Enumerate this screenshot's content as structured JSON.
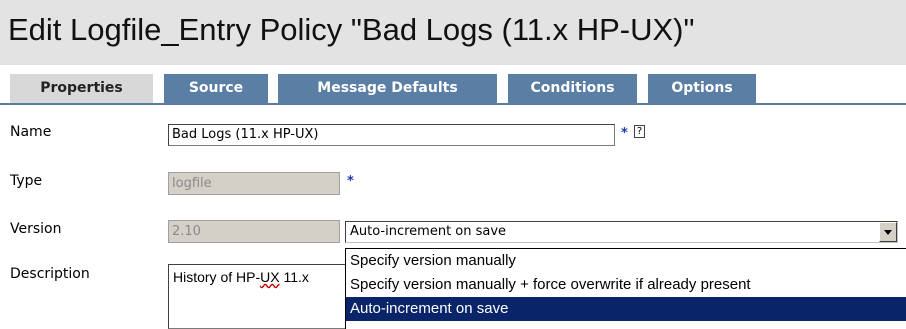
{
  "page": {
    "title": "Edit Logfile_Entry Policy \"Bad Logs (11.x HP-UX)\""
  },
  "tabs": [
    {
      "label": "Properties",
      "active": true
    },
    {
      "label": "Source",
      "active": false
    },
    {
      "label": "Message Defaults",
      "active": false
    },
    {
      "label": "Conditions",
      "active": false
    },
    {
      "label": "Options",
      "active": false
    }
  ],
  "form": {
    "name": {
      "label": "Name",
      "value": "Bad Logs (11.x HP-UX)",
      "required_marker": "*",
      "help_icon": "?"
    },
    "type": {
      "label": "Type",
      "value": "logfile",
      "required_marker": "*"
    },
    "version": {
      "label": "Version",
      "value": "2.10",
      "mode_selected": "Auto-increment on save",
      "mode_options": [
        "Specify version manually",
        "Specify version manually + force overwrite if already present",
        "Auto-increment on save"
      ]
    },
    "description": {
      "label": "Description",
      "value_prefix": "History of HP-",
      "value_underlined": "UX",
      "value_suffix": " 11.x"
    }
  },
  "colors": {
    "tab_active_bg": "#d8d8d8",
    "tab_inactive_bg": "#5b7ea4",
    "title_bar_bg": "#e3e3e3",
    "selected_option_bg": "#0a246a",
    "required_marker": "#1a3aa8"
  },
  "icons": {
    "help": "help-icon",
    "dropdown": "chevron-down-icon"
  }
}
